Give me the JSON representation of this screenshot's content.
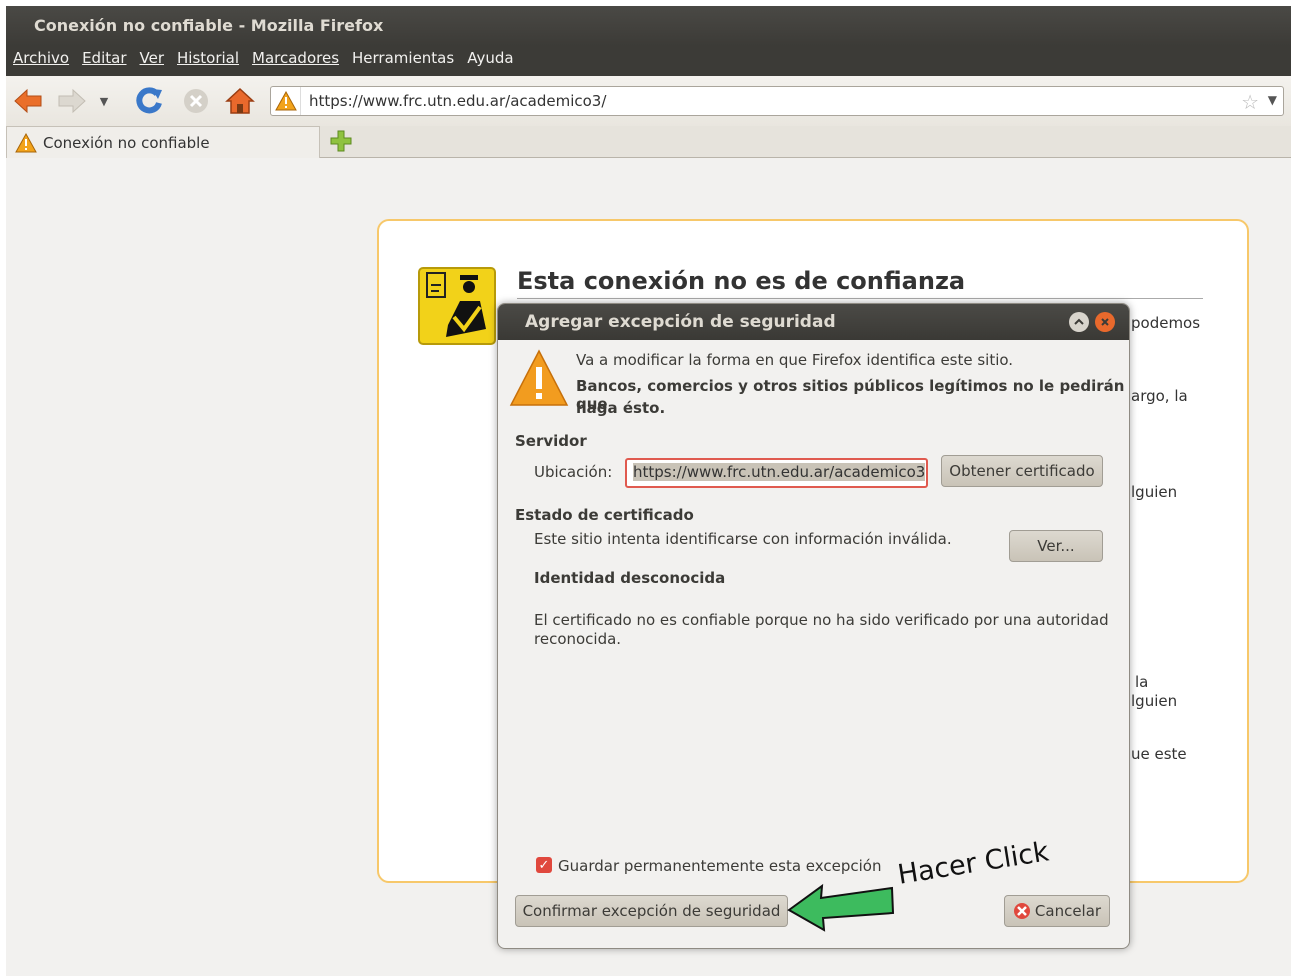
{
  "window": {
    "title": "Conexión no confiable - Mozilla Firefox"
  },
  "menu": [
    "Archivo",
    "Editar",
    "Ver",
    "Historial",
    "Marcadores",
    "Herramientas",
    "Ayuda"
  ],
  "nav": {
    "url": "https://www.frc.utn.edu.ar/academico3/"
  },
  "tab": {
    "label": "Conexión no confiable"
  },
  "page": {
    "title": "Esta conexión no es de confianza",
    "fragments": [
      "podemos",
      "argo, la",
      "lguien",
      "la",
      "lguien",
      "ue este"
    ]
  },
  "dialog": {
    "title": "Agregar excepción de seguridad",
    "warning_line1": "Va a modificar la forma en que Firefox identifica este sitio.",
    "warning_line2": "Bancos, comercios y otros sitios públicos legítimos no le pedirán que",
    "warning_line3": "haga ésto.",
    "server_heading": "Servidor",
    "location_label": "Ubicación:",
    "location_value": "https://www.frc.utn.edu.ar/academico3",
    "get_cert_button": "Obtener certificado",
    "cert_status_heading": "Estado de certificado",
    "cert_status_text": "Este sitio intenta identificarse con información inválida.",
    "view_button": "Ver...",
    "identity_heading": "Identidad desconocida",
    "identity_text_1": "El certificado no es confiable porque no ha sido verificado por una autoridad",
    "identity_text_2": "reconocida.",
    "checkbox_label": "Guardar permanentemente esta excepción",
    "checkbox_checked": true,
    "confirm_button": "Confirmar excepción de seguridad",
    "cancel_button": "Cancelar"
  },
  "annotation": {
    "text": "Hacer Click",
    "arrow_color": "#3dbb5e"
  },
  "colors": {
    "titlebar": "#3c3b37",
    "accent_orange": "#e9692c",
    "warning_border": "#f7c86a",
    "input_error": "#e05a4f"
  },
  "icons": [
    "back-icon",
    "forward-icon",
    "history-dropdown-icon",
    "reload-icon",
    "stop-icon",
    "home-icon",
    "warning-icon",
    "bookmark-star-icon",
    "new-tab-icon",
    "police-icon",
    "close-icon",
    "minimize-icon"
  ]
}
